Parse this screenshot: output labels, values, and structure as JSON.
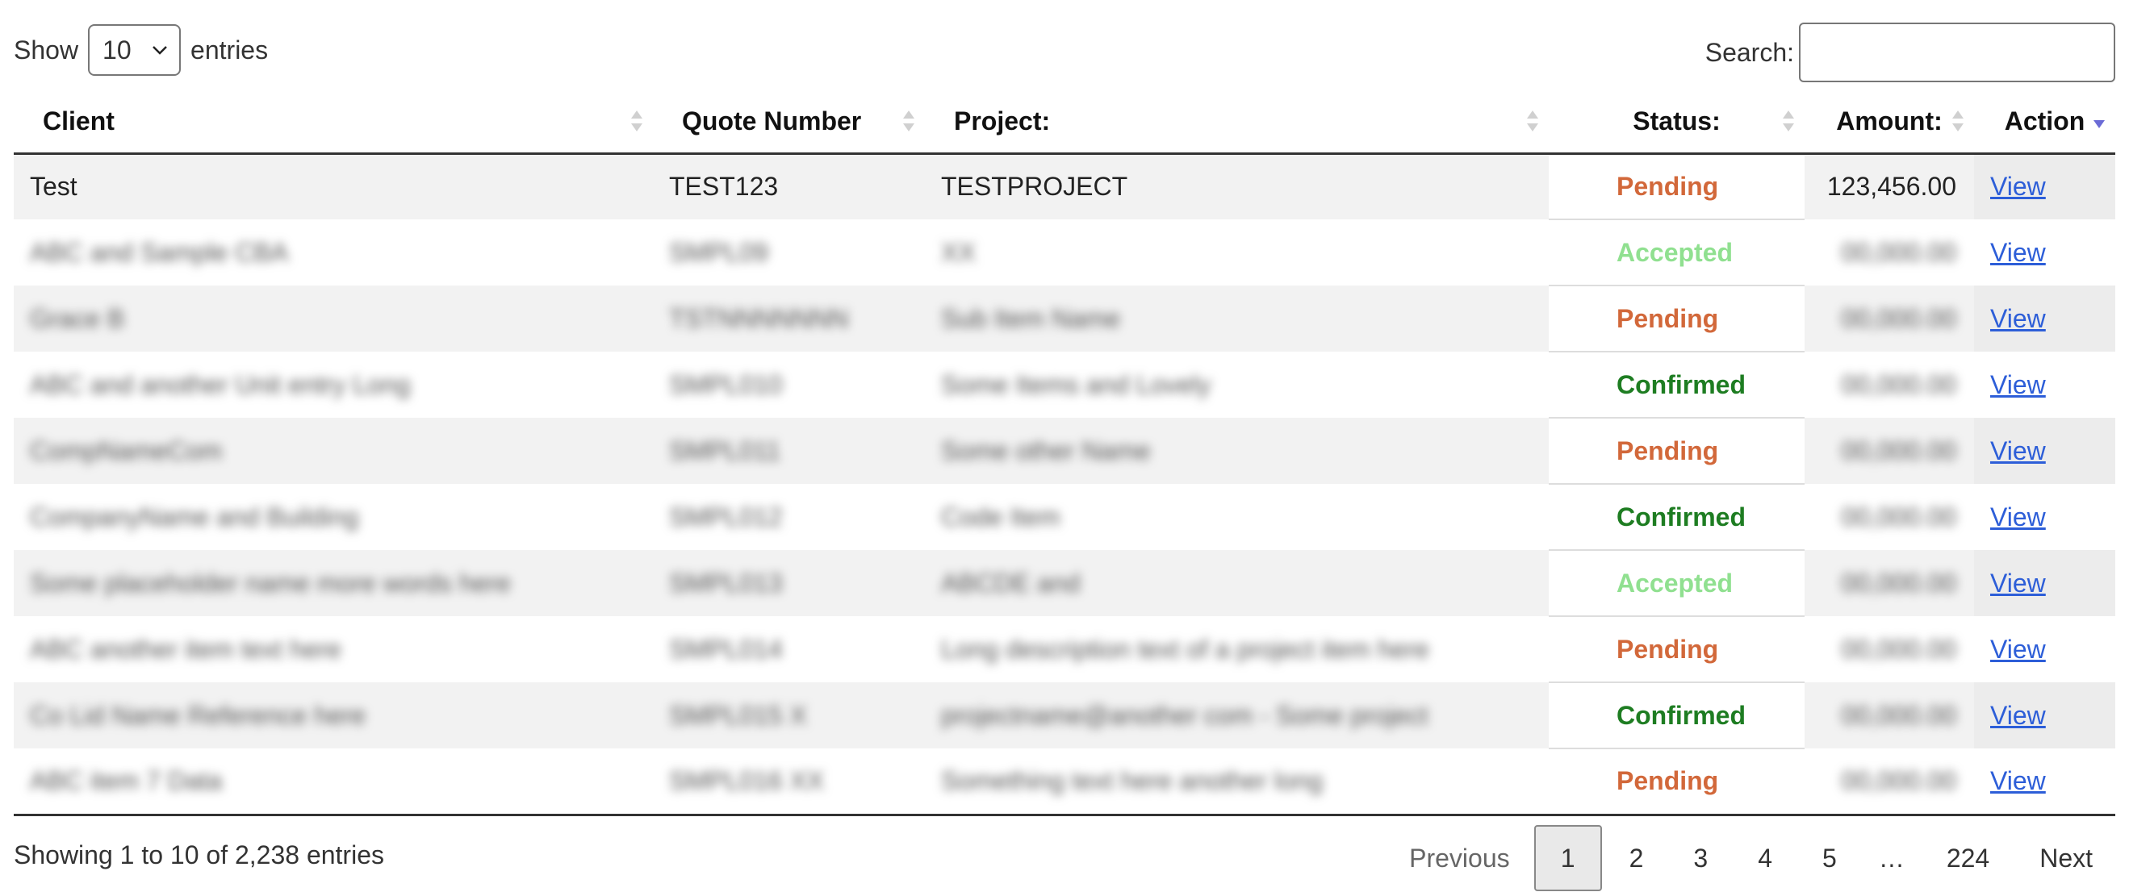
{
  "length_menu": {
    "prefix": "Show",
    "value": "10",
    "suffix": "entries"
  },
  "search": {
    "label": "Search:",
    "value": ""
  },
  "columns": {
    "client": "Client",
    "quote_number": "Quote Number",
    "project": "Project:",
    "status": "Status:",
    "amount": "Amount:",
    "action": "Action"
  },
  "sort_state": {
    "active_column": "Action",
    "direction": "descending"
  },
  "rows": [
    {
      "client": "Test",
      "quote": "TEST123",
      "project": "TESTPROJECT",
      "status": "Pending",
      "amount": "123,456.00",
      "action": "View",
      "redacted": false
    },
    {
      "client": "",
      "quote": "",
      "project": "",
      "status": "Accepted",
      "amount": "",
      "action": "View",
      "redacted": true
    },
    {
      "client": "",
      "quote": "",
      "project": "",
      "status": "Pending",
      "amount": "",
      "action": "View",
      "redacted": true
    },
    {
      "client": "",
      "quote": "",
      "project": "",
      "status": "Confirmed",
      "amount": "",
      "action": "View",
      "redacted": true
    },
    {
      "client": "",
      "quote": "",
      "project": "",
      "status": "Pending",
      "amount": "",
      "action": "View",
      "redacted": true
    },
    {
      "client": "",
      "quote": "",
      "project": "",
      "status": "Confirmed",
      "amount": "",
      "action": "View",
      "redacted": true
    },
    {
      "client": "",
      "quote": "",
      "project": "",
      "status": "Accepted",
      "amount": "",
      "action": "View",
      "redacted": true
    },
    {
      "client": "",
      "quote": "",
      "project": "",
      "status": "Pending",
      "amount": "",
      "action": "View",
      "redacted": true
    },
    {
      "client": "",
      "quote": "",
      "project": "",
      "status": "Confirmed",
      "amount": "",
      "action": "View",
      "redacted": true
    },
    {
      "client": "",
      "quote": "",
      "project": "",
      "status": "Pending",
      "amount": "",
      "action": "View",
      "redacted": true
    }
  ],
  "status_colors": {
    "Pending": "#d2683a",
    "Accepted": "#90e090",
    "Confirmed": "#1e7d22"
  },
  "link_color": "#2d5ed8",
  "info": "Showing 1 to 10 of 2,238 entries",
  "pagination": {
    "previous": "Previous",
    "pages": [
      "1",
      "2",
      "3",
      "4",
      "5",
      "…",
      "224"
    ],
    "current": "1",
    "next": "Next"
  },
  "icons": {
    "select": "chevron-down-icon",
    "sort": "sort-arrows-icon",
    "sort_active": "sort-desc-icon"
  }
}
